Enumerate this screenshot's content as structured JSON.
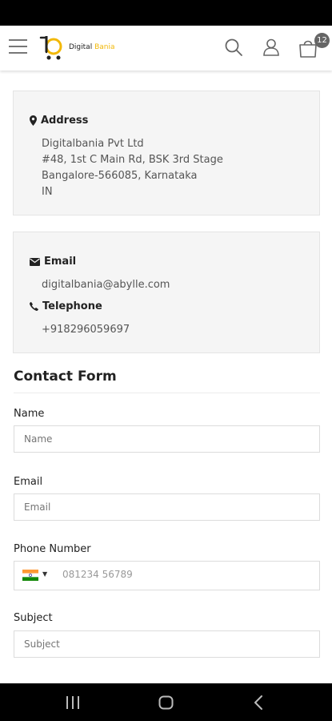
{
  "app": {
    "logo_text_first": "Digital",
    "logo_text_second": "Bania",
    "cart_count": "12",
    "colors": {
      "brand_yellow": "#f2b807",
      "box_bg": "#f5f5f5"
    }
  },
  "header": {
    "icons": [
      "hamburger-menu-icon",
      "search-icon",
      "user-icon",
      "shopping-bag-icon"
    ]
  },
  "address": {
    "heading": "Address",
    "lines": [
      "Digitalbania Pvt Ltd",
      "#48, 1st C Main Rd, BSK 3rd Stage",
      "Bangalore-566085, Karnataka",
      "IN"
    ]
  },
  "contact": {
    "email_heading": "Email",
    "email_value": "digitalbania@abylle.com",
    "phone_heading": "Telephone",
    "phone_value": "+918296059697"
  },
  "form": {
    "title": "Contact Form",
    "name_label": "Name",
    "name_placeholder": "Name",
    "email_label": "Email",
    "email_placeholder": "Email",
    "phone_label": "Phone Number",
    "phone_placeholder": "081234 56789",
    "subject_label": "Subject",
    "subject_placeholder": "Subject"
  }
}
